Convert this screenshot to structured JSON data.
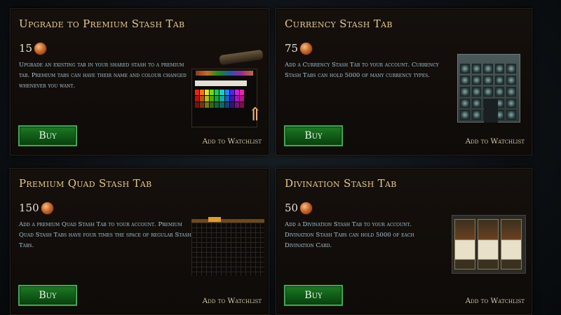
{
  "cards": [
    {
      "title": "Upgrade to Premium Stash Tab",
      "price": "15",
      "description": "Upgrade an existing tab in your shared stash to a premium tab. Premium tabs can have their name and colour changed whenever you want.",
      "buy_label": "Buy",
      "watchlist_label": "Add to Watchlist",
      "art_icon": "premium-tab-color-palette"
    },
    {
      "title": "Currency Stash Tab",
      "price": "75",
      "description": "Add a Currency Stash Tab to your account. Currency Stash Tabs can hold 5000 of many currency types.",
      "buy_label": "Buy",
      "watchlist_label": "Add to Watchlist",
      "art_icon": "currency-stash-grid"
    },
    {
      "title": "Premium Quad Stash Tab",
      "price": "150",
      "description": "Add a premium Quad Stash Tab to your account. Premium Quad Stash Tabs have four times the space of regular Stash Tabs.",
      "buy_label": "Buy",
      "watchlist_label": "Add to Watchlist",
      "art_icon": "quad-stash-grid"
    },
    {
      "title": "Divination Stash Tab",
      "price": "50",
      "description": "Add a Divination Stash Tab to your account. Divination Stash Tabs can hold 5000 of each Divination Card.",
      "buy_label": "Buy",
      "watchlist_label": "Add to Watchlist",
      "art_icon": "divination-cards"
    }
  ],
  "colors": {
    "title": "#e9c98a",
    "description": "#a8c6d6",
    "buy_bg": "#0f5a16",
    "buy_border": "#4ba15a",
    "coin": "#c96a2e"
  }
}
